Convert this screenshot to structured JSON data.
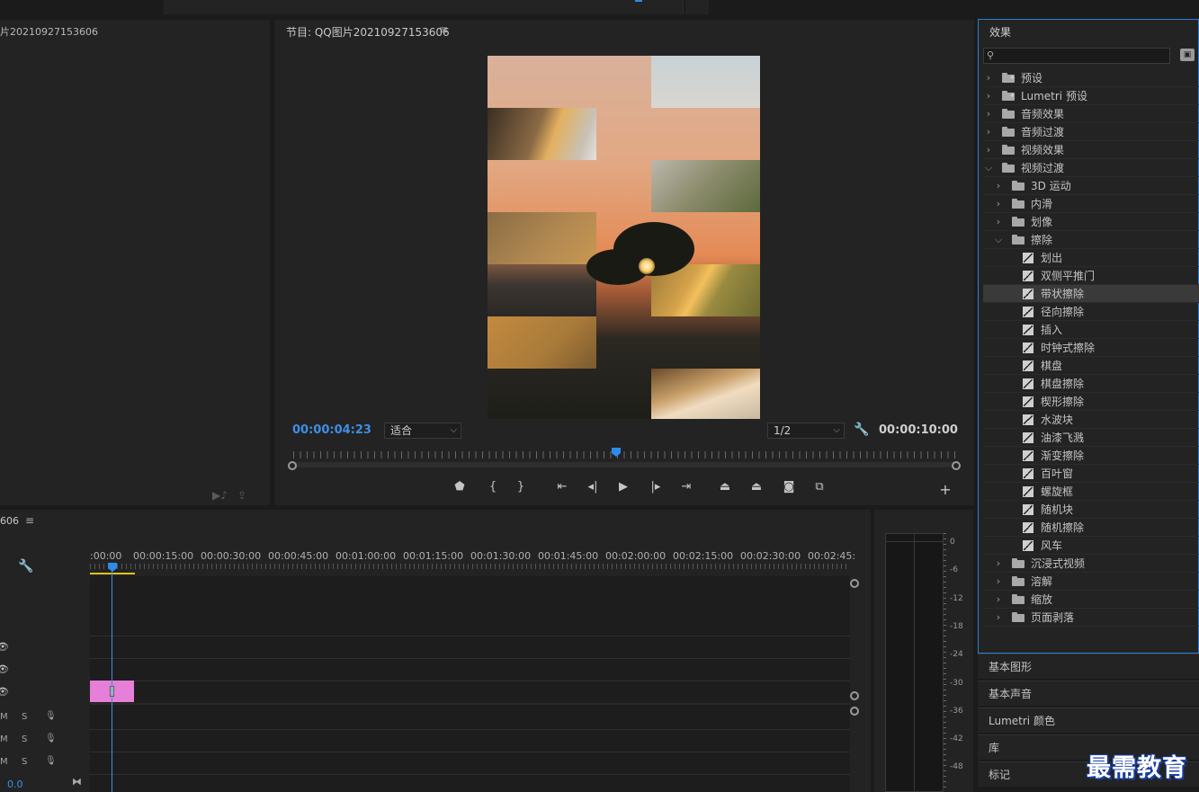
{
  "app": {
    "accent": "#2d8ceb",
    "clip_color": "#e67fd8",
    "workarea_color": "#e2c21c"
  },
  "source_panel": {
    "title": "片20210927153606"
  },
  "program_panel": {
    "title": "节目: QQ图片20210927153606",
    "menu_icon": "≡",
    "current_timecode": "00:00:04:23",
    "zoom_select": "适合",
    "resolution_select": "1/2",
    "duration_timecode": "00:00:10:00",
    "transport": [
      {
        "name": "add-marker-button",
        "glyph": "⬟"
      },
      {
        "name": "mark-in-button",
        "glyph": "{"
      },
      {
        "name": "mark-out-button",
        "glyph": "}"
      },
      {
        "name": "go-to-in-button",
        "glyph": "⇤"
      },
      {
        "name": "step-back-button",
        "glyph": "◂|"
      },
      {
        "name": "play-button",
        "glyph": "▶"
      },
      {
        "name": "step-forward-button",
        "glyph": "|▸"
      },
      {
        "name": "go-to-out-button",
        "glyph": "⇥"
      },
      {
        "name": "lift-button",
        "glyph": "⏏"
      },
      {
        "name": "extract-button",
        "glyph": "⏏"
      },
      {
        "name": "export-frame-button",
        "glyph": "◙"
      },
      {
        "name": "comparison-view-button",
        "glyph": "⧉"
      }
    ],
    "add_button": "+"
  },
  "timeline": {
    "title": "606",
    "menu_icon": "≡",
    "time_labels": [
      ":00:00",
      "00:00:15:00",
      "00:00:30:00",
      "00:00:45:00",
      "00:01:00:00",
      "00:01:15:00",
      "00:01:30:00",
      "00:01:45:00",
      "00:02:00:00",
      "00:02:15:00",
      "00:02:30:00",
      "00:02:45:"
    ],
    "audio_track_m": "M",
    "audio_track_s": "S",
    "bottom_value": "0.0"
  },
  "audio_meter": {
    "db_labels": [
      "0",
      "-6",
      "-12",
      "-18",
      "-24",
      "-30",
      "-36",
      "-42",
      "-48"
    ]
  },
  "effects_panel": {
    "title": "效果",
    "search_value": "",
    "items": [
      {
        "label": "预设",
        "level": 0,
        "type": "folder-star",
        "expanded": false
      },
      {
        "label": "Lumetri 预设",
        "level": 0,
        "type": "folder-star",
        "expanded": false
      },
      {
        "label": "音频效果",
        "level": 0,
        "type": "folder",
        "expanded": false
      },
      {
        "label": "音频过渡",
        "level": 0,
        "type": "folder",
        "expanded": false
      },
      {
        "label": "视频效果",
        "level": 0,
        "type": "folder",
        "expanded": false
      },
      {
        "label": "视频过渡",
        "level": 0,
        "type": "folder",
        "expanded": true
      },
      {
        "label": "3D 运动",
        "level": 1,
        "type": "folder",
        "expanded": false
      },
      {
        "label": "内滑",
        "level": 1,
        "type": "folder",
        "expanded": false
      },
      {
        "label": "划像",
        "level": 1,
        "type": "folder",
        "expanded": false
      },
      {
        "label": "擦除",
        "level": 1,
        "type": "folder",
        "expanded": true
      },
      {
        "label": "划出",
        "level": 2,
        "type": "effect"
      },
      {
        "label": "双侧平推门",
        "level": 2,
        "type": "effect"
      },
      {
        "label": "带状擦除",
        "level": 2,
        "type": "effect",
        "selected": true
      },
      {
        "label": "径向擦除",
        "level": 2,
        "type": "effect"
      },
      {
        "label": "插入",
        "level": 2,
        "type": "effect"
      },
      {
        "label": "时钟式擦除",
        "level": 2,
        "type": "effect"
      },
      {
        "label": "棋盘",
        "level": 2,
        "type": "effect"
      },
      {
        "label": "棋盘擦除",
        "level": 2,
        "type": "effect"
      },
      {
        "label": "楔形擦除",
        "level": 2,
        "type": "effect"
      },
      {
        "label": "水波块",
        "level": 2,
        "type": "effect"
      },
      {
        "label": "油漆飞溅",
        "level": 2,
        "type": "effect"
      },
      {
        "label": "渐变擦除",
        "level": 2,
        "type": "effect"
      },
      {
        "label": "百叶窗",
        "level": 2,
        "type": "effect"
      },
      {
        "label": "螺旋框",
        "level": 2,
        "type": "effect"
      },
      {
        "label": "随机块",
        "level": 2,
        "type": "effect"
      },
      {
        "label": "随机擦除",
        "level": 2,
        "type": "effect"
      },
      {
        "label": "风车",
        "level": 2,
        "type": "effect"
      },
      {
        "label": "沉浸式视频",
        "level": 1,
        "type": "folder",
        "expanded": false
      },
      {
        "label": "溶解",
        "level": 1,
        "type": "folder",
        "expanded": false
      },
      {
        "label": "缩放",
        "level": 1,
        "type": "folder",
        "expanded": false
      },
      {
        "label": "页面剥落",
        "level": 1,
        "type": "folder",
        "expanded": false
      }
    ]
  },
  "side_panels": [
    "基本图形",
    "基本声音",
    "Lumetri 颜色",
    "库",
    "标记"
  ],
  "watermark": "最需教育"
}
